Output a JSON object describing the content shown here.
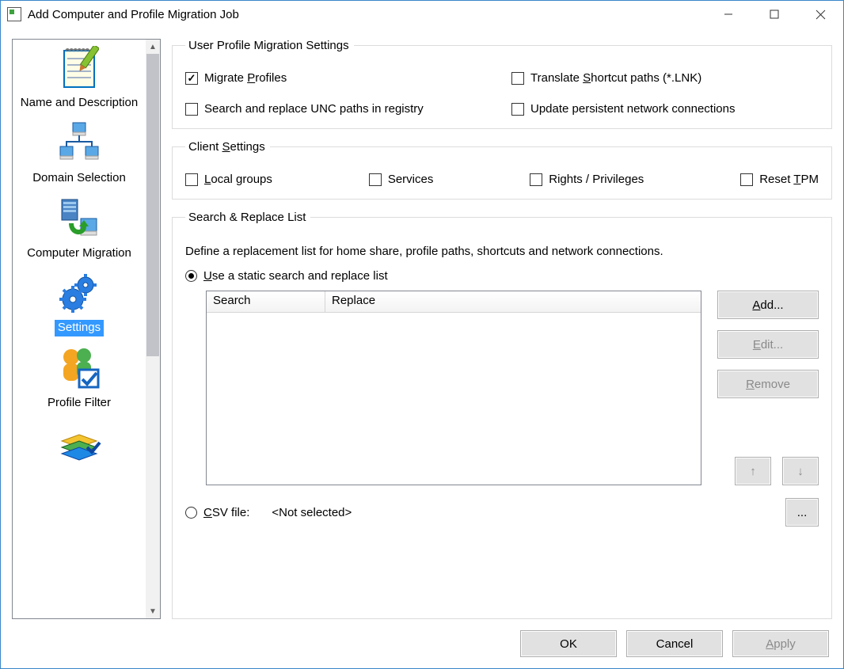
{
  "window": {
    "title": "Add Computer and Profile Migration Job"
  },
  "sidebar": {
    "items": [
      {
        "label": "Name and Description",
        "selected": false
      },
      {
        "label": "Domain Selection",
        "selected": false
      },
      {
        "label": "Computer Migration",
        "selected": false
      },
      {
        "label": "Settings",
        "selected": true
      },
      {
        "label": "Profile Filter",
        "selected": false
      }
    ]
  },
  "groups": {
    "userProfile": {
      "legend": "User Profile Migration Settings",
      "migrateProfiles": {
        "pre": "Migrate ",
        "u": "P",
        "post": "rofiles",
        "checked": true
      },
      "translateShortcut": {
        "pre": "Translate ",
        "u": "S",
        "post": "hortcut paths (*.LNK)",
        "checked": false
      },
      "searchReplaceUNC": {
        "label": "Search and replace UNC paths in registry",
        "checked": false
      },
      "updatePersistent": {
        "label": "Update persistent network connections",
        "checked": false
      }
    },
    "client": {
      "legend_pre": "Client ",
      "legend_u": "S",
      "legend_post": "ettings",
      "localGroups": {
        "u": "L",
        "post": "ocal groups",
        "checked": false
      },
      "services": {
        "label": "Services",
        "checked": false
      },
      "rights": {
        "label": "Rights / Privileges",
        "checked": false
      },
      "resetTPM": {
        "pre": "Reset ",
        "u": "T",
        "post": "PM",
        "checked": false
      }
    },
    "searchReplace": {
      "legend": "Search & Replace List",
      "description": "Define a replacement list for home share, profile paths, shortcuts and network connections.",
      "staticOption": {
        "u": "U",
        "post": "se a static search and replace list",
        "checked": true
      },
      "table": {
        "colSearch": "Search",
        "colReplace": "Replace",
        "rows": []
      },
      "buttons": {
        "add_u": "A",
        "add_post": "dd...",
        "edit_u": "E",
        "edit_post": "dit...",
        "remove_u": "R",
        "remove_post": "emove",
        "up": "↑",
        "down": "↓"
      },
      "csvOption": {
        "u": "C",
        "post": "SV file:",
        "checked": false,
        "path": "<Not selected>"
      },
      "browse": "..."
    }
  },
  "footer": {
    "ok": "OK",
    "cancel": "Cancel",
    "apply_u": "A",
    "apply_post": "pply"
  }
}
